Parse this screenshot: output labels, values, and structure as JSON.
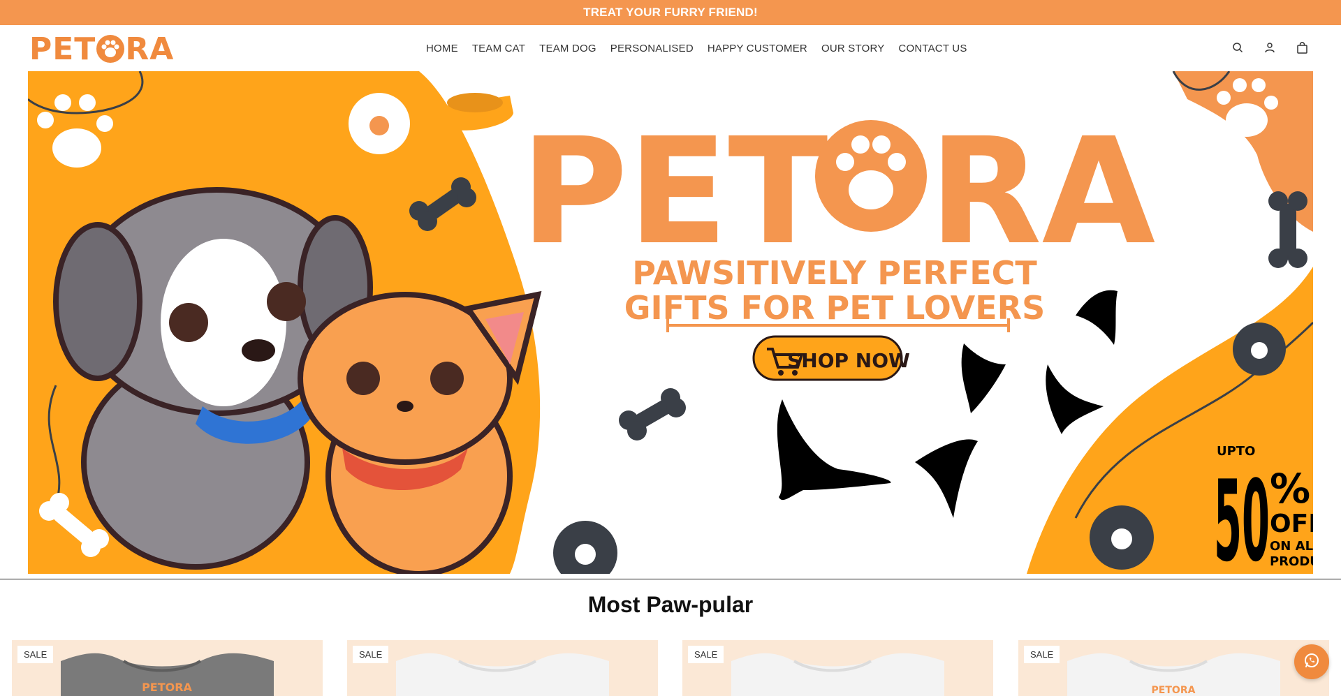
{
  "announcement": "TREAT YOUR FURRY FRIEND!",
  "brand": {
    "logo_text_left": "PET",
    "logo_text_right": "RA",
    "color": "#f08a3e"
  },
  "nav": {
    "items": [
      {
        "label": "HOME"
      },
      {
        "label": "TEAM CAT"
      },
      {
        "label": "TEAM DOG"
      },
      {
        "label": "PERSONALISED"
      },
      {
        "label": "HAPPY CUSTOMER"
      },
      {
        "label": "OUR STORY"
      },
      {
        "label": "CONTACT US"
      }
    ]
  },
  "header_icons": [
    "search-icon",
    "account-icon",
    "cart-bag-icon"
  ],
  "hero": {
    "brand_left": "PET",
    "brand_right": "RA",
    "tagline_line1": "PAWSITIVELY PERFECT",
    "tagline_line2": "GIFTS FOR PET LOVERS",
    "cta": "SHOP NOW",
    "promo_upto": "UPTO",
    "promo_value": "50",
    "promo_percent": "%",
    "promo_off": "OFF",
    "promo_on_all": "ON ALL",
    "promo_product": "PRODUCT",
    "colors": {
      "orange": "#ffa41a",
      "peach": "#f4964f",
      "dark": "#3a3f47"
    }
  },
  "section": {
    "title": "Most Paw-pular"
  },
  "products": [
    {
      "badge": "SALE",
      "logo": "PETORA"
    },
    {
      "badge": "SALE"
    },
    {
      "badge": "SALE"
    },
    {
      "badge": "SALE",
      "logo": "PETORA"
    }
  ],
  "whatsapp": "whatsapp-icon"
}
